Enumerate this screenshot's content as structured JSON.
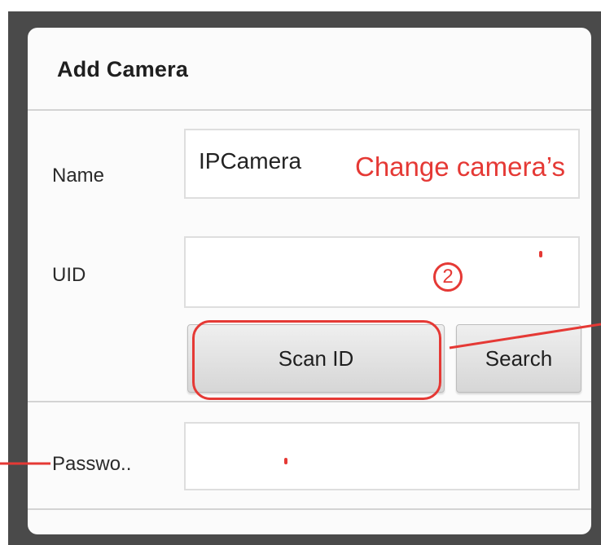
{
  "dialog": {
    "title": "Add Camera"
  },
  "fields": {
    "name_label": "Name",
    "name_value": "IPCamera",
    "uid_label": "UID",
    "uid_value": "",
    "password_label": "Passwo..",
    "password_value": ""
  },
  "buttons": {
    "scan_id": "Scan ID",
    "search": "Search"
  },
  "annotations": {
    "change_name_text": "Change camera’s",
    "step_number": "2"
  },
  "colors": {
    "accent_red": "#e53935",
    "frame": "#4a4a4a",
    "dialog_bg": "#fbfbfb"
  }
}
